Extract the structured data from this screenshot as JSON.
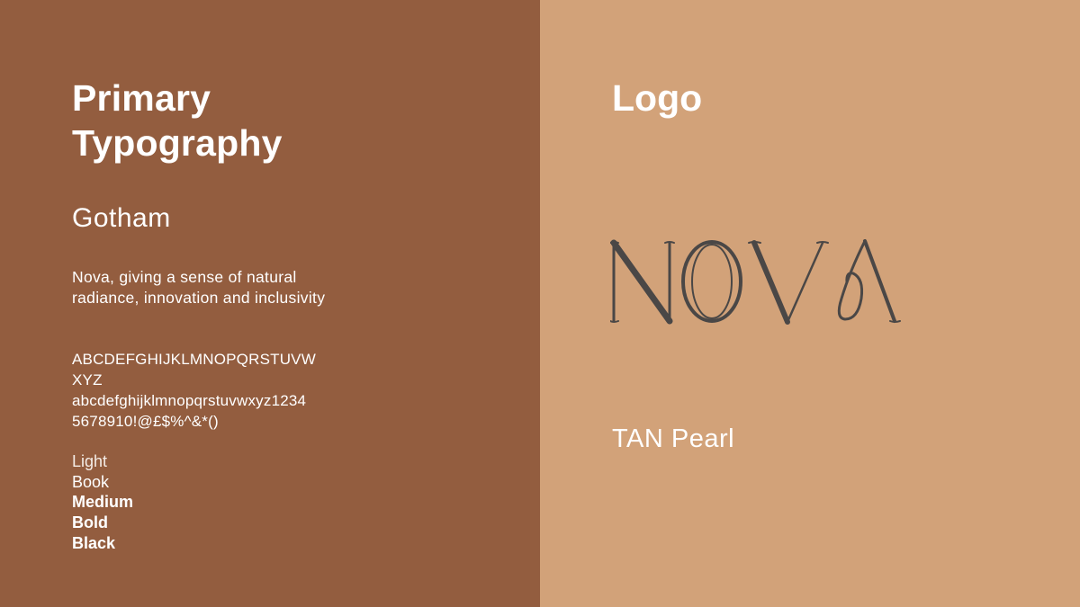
{
  "typography": {
    "heading_line1": "Primary",
    "heading_line2": "Typography",
    "font_name": "Gotham",
    "description": "Nova, giving a sense of natural radiance, innovation and inclusivity",
    "charset_line1": "ABCDEFGHIJKLMNOPQRSTUVW",
    "charset_line2": "XYZ",
    "charset_line3": "abcdefghijklmnopqrstuvwxyz1234",
    "charset_line4": "5678910!@£$%^&*()",
    "weights": [
      "Light",
      "Book",
      "Medium",
      "Bold",
      "Black"
    ]
  },
  "logo": {
    "heading": "Logo",
    "wordmark": "NOVA",
    "caption": "TAN Pearl"
  },
  "colors": {
    "left_panel": "#935d3f",
    "right_panel": "#d2a279",
    "text": "#ffffff",
    "logo_ink": "#4a4746"
  }
}
